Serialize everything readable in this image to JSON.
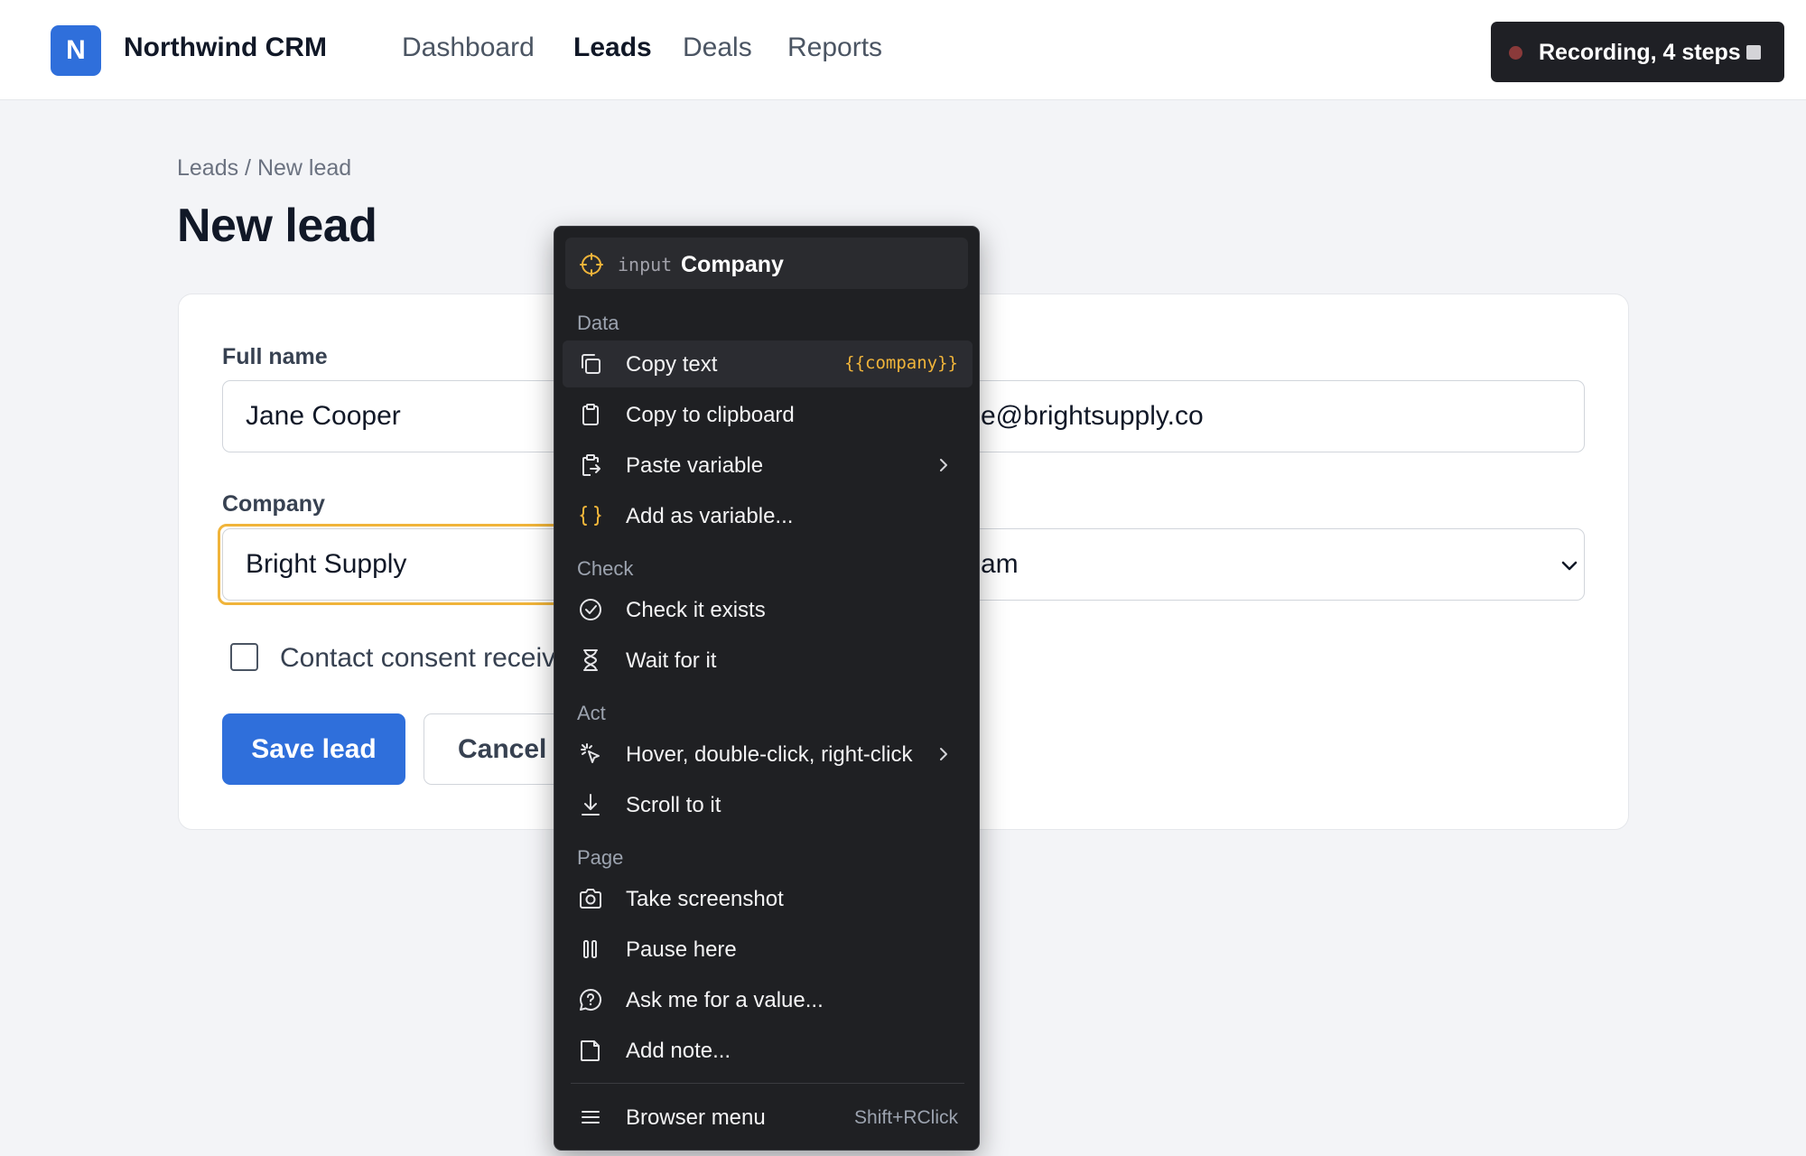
{
  "app": {
    "logo_letter": "N",
    "brand": "Northwind CRM",
    "accent_color": "#2f6fdb"
  },
  "nav": {
    "items": [
      {
        "label": "Dashboard",
        "active": false
      },
      {
        "label": "Leads",
        "active": true
      },
      {
        "label": "Deals",
        "active": false
      },
      {
        "label": "Reports",
        "active": false
      }
    ]
  },
  "recording": {
    "label": "Recording, 4 steps",
    "dot_icon": "record-dot-icon",
    "stop_icon": "stop-icon"
  },
  "page": {
    "breadcrumb": "Leads / New lead",
    "title": "New lead"
  },
  "form": {
    "full_name": {
      "label": "Full name",
      "value": "Jane Cooper"
    },
    "email": {
      "value_visible": "e@brightsupply.co"
    },
    "company": {
      "label": "Company",
      "value": "Bright Supply",
      "focus_color": "#f0b43a"
    },
    "select": {
      "value_visible": "am"
    },
    "consent": {
      "label": "Contact consent receiv",
      "checked": false
    },
    "save_label": "Save lead",
    "cancel_label": "Cancel"
  },
  "context_menu": {
    "header": {
      "tag": "input",
      "target": "Company",
      "icon": "crosshair-icon"
    },
    "sections": {
      "data": "Data",
      "check": "Check",
      "act": "Act",
      "page": "Page"
    },
    "items": {
      "copy_text": {
        "label": "Copy text",
        "variable": "{{company}}",
        "icon": "copy-icon"
      },
      "copy_clipboard": {
        "label": "Copy to clipboard",
        "icon": "clipboard-icon"
      },
      "paste_variable": {
        "label": "Paste variable",
        "icon": "paste-icon",
        "submenu": true
      },
      "add_variable": {
        "label": "Add as variable...",
        "icon": "braces-icon"
      },
      "check_exists": {
        "label": "Check it exists",
        "icon": "check-circle-icon"
      },
      "wait_for": {
        "label": "Wait for it",
        "icon": "hourglass-icon"
      },
      "hover_click": {
        "label": "Hover, double-click, right-click",
        "icon": "click-icon",
        "submenu": true
      },
      "scroll_to": {
        "label": "Scroll to it",
        "icon": "scroll-down-icon"
      },
      "screenshot": {
        "label": "Take screenshot",
        "icon": "camera-icon"
      },
      "pause": {
        "label": "Pause here",
        "icon": "pause-icon"
      },
      "ask_value": {
        "label": "Ask me for a value...",
        "icon": "question-bubble-icon"
      },
      "add_note": {
        "label": "Add note...",
        "icon": "note-icon"
      },
      "browser_menu": {
        "label": "Browser menu",
        "shortcut": "Shift+RClick",
        "icon": "hamburger-icon"
      }
    }
  }
}
